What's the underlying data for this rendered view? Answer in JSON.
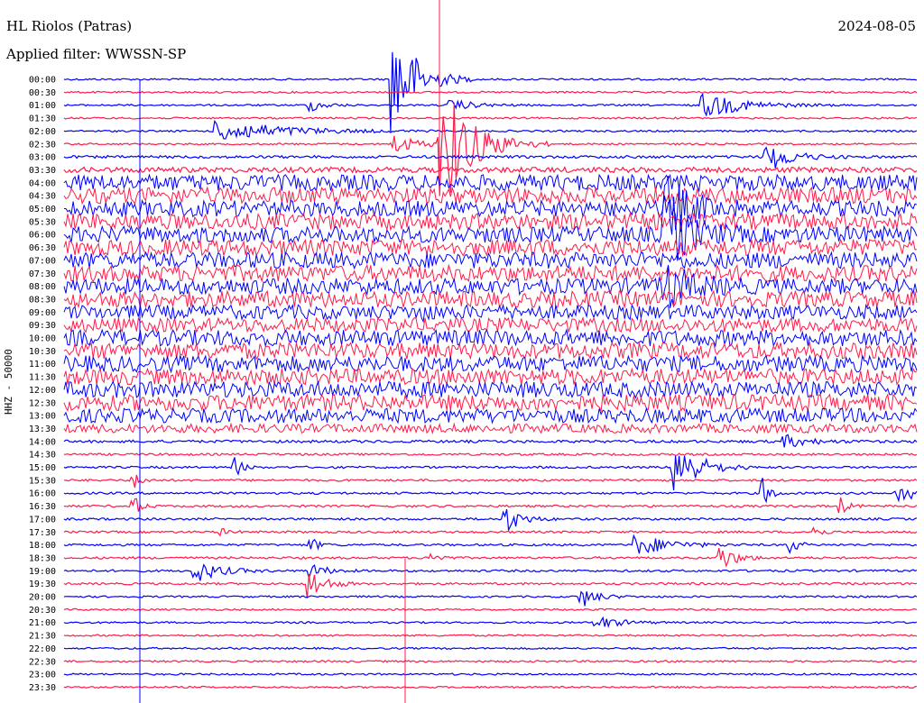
{
  "header": {
    "station": "HL Riolos (Patras)",
    "filter_label": "Applied filter: WWSSN-SP",
    "date": "2024-08-05"
  },
  "yaxis_label": "HHZ - 50000",
  "colors": {
    "blue": "#0000ff",
    "red": "#ff1a4a"
  },
  "chart_data": {
    "type": "line",
    "title": "HL Riolos (Patras)",
    "subtitle": "Applied filter: WWSSN-SP",
    "ylabel": "HHZ - 50000",
    "row_labels": [
      "00:00",
      "00:30",
      "01:00",
      "01:30",
      "02:00",
      "02:30",
      "03:00",
      "03:30",
      "04:00",
      "04:30",
      "05:00",
      "05:30",
      "06:00",
      "06:30",
      "07:00",
      "07:30",
      "08:00",
      "08:30",
      "09:00",
      "09:30",
      "10:00",
      "10:30",
      "11:00",
      "11:30",
      "12:00",
      "12:30",
      "13:00",
      "13:30",
      "14:00",
      "14:30",
      "15:00",
      "15:30",
      "16:00",
      "16:30",
      "17:00",
      "17:30",
      "18:00",
      "18:30",
      "19:00",
      "19:30",
      "20:00",
      "20:30",
      "21:00",
      "21:30",
      "22:00",
      "22:30",
      "23:00",
      "23:30"
    ],
    "row_colors": [
      "blue",
      "red"
    ],
    "noise_levels": [
      1,
      1,
      1,
      1,
      1,
      1,
      1.5,
      3,
      9,
      9,
      9,
      9,
      9,
      9,
      9,
      9,
      9,
      9,
      8,
      8,
      9,
      9,
      9,
      9,
      9,
      9,
      8,
      5,
      1.5,
      1.2,
      1.2,
      1.2,
      1.2,
      1.2,
      1.2,
      1.2,
      1.2,
      1.2,
      1.2,
      1.2,
      1,
      1,
      1,
      1,
      1,
      1,
      1,
      1
    ],
    "events": [
      {
        "row": 2,
        "pos": 0.29,
        "amp": 6,
        "dur": 0.02
      },
      {
        "row": 2,
        "pos": 0.46,
        "amp": 5,
        "dur": 0.03
      },
      {
        "row": 2,
        "pos": 0.76,
        "amp": 12,
        "dur": 0.05
      },
      {
        "row": 4,
        "pos": 0.2,
        "amp": 10,
        "dur": 0.08
      },
      {
        "row": 5,
        "pos": 0.39,
        "amp": 10,
        "dur": 0.03
      },
      {
        "row": 6,
        "pos": 0.83,
        "amp": 14,
        "dur": 0.03
      },
      {
        "row": 0,
        "pos": 0.39,
        "amp": 60,
        "dur": 0.03
      },
      {
        "row": 5,
        "pos": 0.45,
        "amp": 60,
        "dur": 0.04
      },
      {
        "row": 10,
        "pos": 0.71,
        "amp": 30,
        "dur": 0.03
      },
      {
        "row": 12,
        "pos": 0.71,
        "amp": 35,
        "dur": 0.03
      },
      {
        "row": 16,
        "pos": 0.71,
        "amp": 20,
        "dur": 0.03
      },
      {
        "row": 18,
        "pos": 0.42,
        "amp": 15,
        "dur": 0.005
      },
      {
        "row": 28,
        "pos": 0.85,
        "amp": 6,
        "dur": 0.03
      },
      {
        "row": 30,
        "pos": 0.2,
        "amp": 12,
        "dur": 0.01
      },
      {
        "row": 30,
        "pos": 0.72,
        "amp": 30,
        "dur": 0.03
      },
      {
        "row": 31,
        "pos": 0.08,
        "amp": 12,
        "dur": 0.01
      },
      {
        "row": 32,
        "pos": 0.82,
        "amp": 16,
        "dur": 0.01
      },
      {
        "row": 32,
        "pos": 0.98,
        "amp": 12,
        "dur": 0.02
      },
      {
        "row": 33,
        "pos": 0.08,
        "amp": 14,
        "dur": 0.01
      },
      {
        "row": 33,
        "pos": 0.91,
        "amp": 10,
        "dur": 0.01
      },
      {
        "row": 34,
        "pos": 0.52,
        "amp": 14,
        "dur": 0.02
      },
      {
        "row": 35,
        "pos": 0.18,
        "amp": 6,
        "dur": 0.01
      },
      {
        "row": 35,
        "pos": 0.88,
        "amp": 8,
        "dur": 0.01
      },
      {
        "row": 36,
        "pos": 0.29,
        "amp": 8,
        "dur": 0.01
      },
      {
        "row": 36,
        "pos": 0.68,
        "amp": 10,
        "dur": 0.04
      },
      {
        "row": 36,
        "pos": 0.85,
        "amp": 12,
        "dur": 0.01
      },
      {
        "row": 37,
        "pos": 0.43,
        "amp": 10,
        "dur": 0.01
      },
      {
        "row": 37,
        "pos": 0.77,
        "amp": 14,
        "dur": 0.02
      },
      {
        "row": 38,
        "pos": 0.16,
        "amp": 10,
        "dur": 0.03
      },
      {
        "row": 38,
        "pos": 0.29,
        "amp": 8,
        "dur": 0.02
      },
      {
        "row": 39,
        "pos": 0.29,
        "amp": 16,
        "dur": 0.02
      },
      {
        "row": 40,
        "pos": 0.61,
        "amp": 10,
        "dur": 0.02
      },
      {
        "row": 42,
        "pos": 0.63,
        "amp": 6,
        "dur": 0.03
      }
    ]
  }
}
